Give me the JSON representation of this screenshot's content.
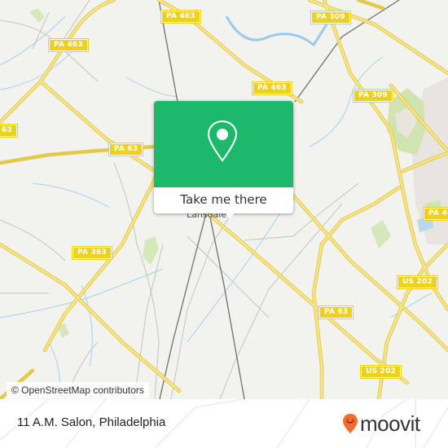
{
  "map": {
    "town_label": "Lansdale",
    "route_shields": [
      {
        "id": "pa463-top",
        "label": "PA 463"
      },
      {
        "id": "pa309-top",
        "label": "PA 309"
      },
      {
        "id": "pa463-left",
        "label": "PA 463"
      },
      {
        "id": "pa463-mid",
        "label": "PA 463"
      },
      {
        "id": "pa309-right",
        "label": "PA 309"
      },
      {
        "id": "pa63-edge",
        "label": "63"
      },
      {
        "id": "pa63-left",
        "label": "PA 63"
      },
      {
        "id": "pa463-edge",
        "label": "PA 46"
      },
      {
        "id": "pa363",
        "label": "PA 363"
      },
      {
        "id": "us202-upper",
        "label": "US 202"
      },
      {
        "id": "pa63-right",
        "label": "PA 63"
      },
      {
        "id": "us202-lower",
        "label": "US 202"
      }
    ],
    "attribution": "© OpenStreetMap contributors"
  },
  "popup": {
    "icon": "location-pin-icon",
    "button_label": "Take me there",
    "color": "#1db96a"
  },
  "footer": {
    "place_name": "11 A.M. Salon, Philadelphia",
    "brand_name": "moovit",
    "brand_color": "#f26b2f"
  }
}
